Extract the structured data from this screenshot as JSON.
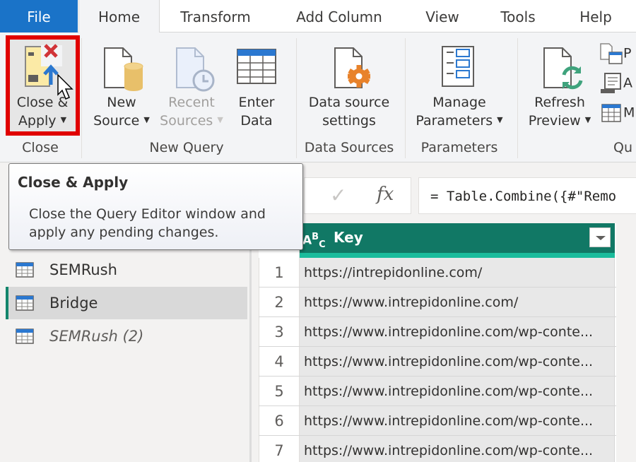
{
  "tabs": [
    {
      "label": "File",
      "active": false
    },
    {
      "label": "Home",
      "active": true
    },
    {
      "label": "Transform",
      "active": false
    },
    {
      "label": "Add Column",
      "active": false
    },
    {
      "label": "View",
      "active": false
    },
    {
      "label": "Tools",
      "active": false
    },
    {
      "label": "Help",
      "active": false
    }
  ],
  "ribbon": {
    "close_apply": {
      "line1": "Close &",
      "line2": "Apply",
      "icon": "close-apply-icon"
    },
    "new_source": {
      "line1": "New",
      "line2": "Source",
      "icon": "new-source-icon"
    },
    "recent_sources": {
      "line1": "Recent",
      "line2": "Sources",
      "icon": "recent-sources-icon",
      "disabled": true
    },
    "enter_data": {
      "line1": "Enter",
      "line2": "Data",
      "icon": "table-icon"
    },
    "data_source_settings": {
      "line1": "Data source",
      "line2": "settings",
      "icon": "settings-gear-icon"
    },
    "manage_parameters": {
      "line1": "Manage",
      "line2": "Parameters",
      "icon": "parameters-icon"
    },
    "refresh_preview": {
      "line1": "Refresh",
      "line2": "Preview",
      "icon": "refresh-icon"
    },
    "small_buttons": [
      {
        "label": "P",
        "icon": "properties-icon"
      },
      {
        "label": "A",
        "icon": "advanced-editor-icon"
      },
      {
        "label": "M",
        "icon": "manage-icon"
      }
    ],
    "groups": {
      "close": "Close",
      "new_query": "New Query",
      "data_sources": "Data Sources",
      "parameters": "Parameters",
      "query": "Qu"
    },
    "highlight_color": "#e00000"
  },
  "tooltip": {
    "title": "Close & Apply",
    "body": "Close the Query Editor window and apply any pending changes."
  },
  "formula_bar": {
    "check_symbol": "✓",
    "fx_symbol": "fx",
    "formula": "= Table.Combine({#\"Remo"
  },
  "queries": [
    {
      "name": "SEMRush",
      "selected": false,
      "italic": false
    },
    {
      "name": "Bridge",
      "selected": true,
      "italic": false
    },
    {
      "name": "SEMRush (2)",
      "selected": false,
      "italic": true
    }
  ],
  "grid": {
    "column": {
      "type_label": "ABC",
      "name": "Key",
      "header_color": "#117865"
    },
    "rows": [
      {
        "n": "1",
        "value": "https://intrepidonline.com/"
      },
      {
        "n": "2",
        "value": "https://www.intrepidonline.com/"
      },
      {
        "n": "3",
        "value": "https://www.intrepidonline.com/wp-conte..."
      },
      {
        "n": "4",
        "value": "https://www.intrepidonline.com/wp-conte..."
      },
      {
        "n": "5",
        "value": "https://www.intrepidonline.com/wp-conte..."
      },
      {
        "n": "6",
        "value": "https://www.intrepidonline.com/wp-conte..."
      },
      {
        "n": "7",
        "value": "https://www.intrepidonline.com/wp-conte..."
      }
    ]
  }
}
